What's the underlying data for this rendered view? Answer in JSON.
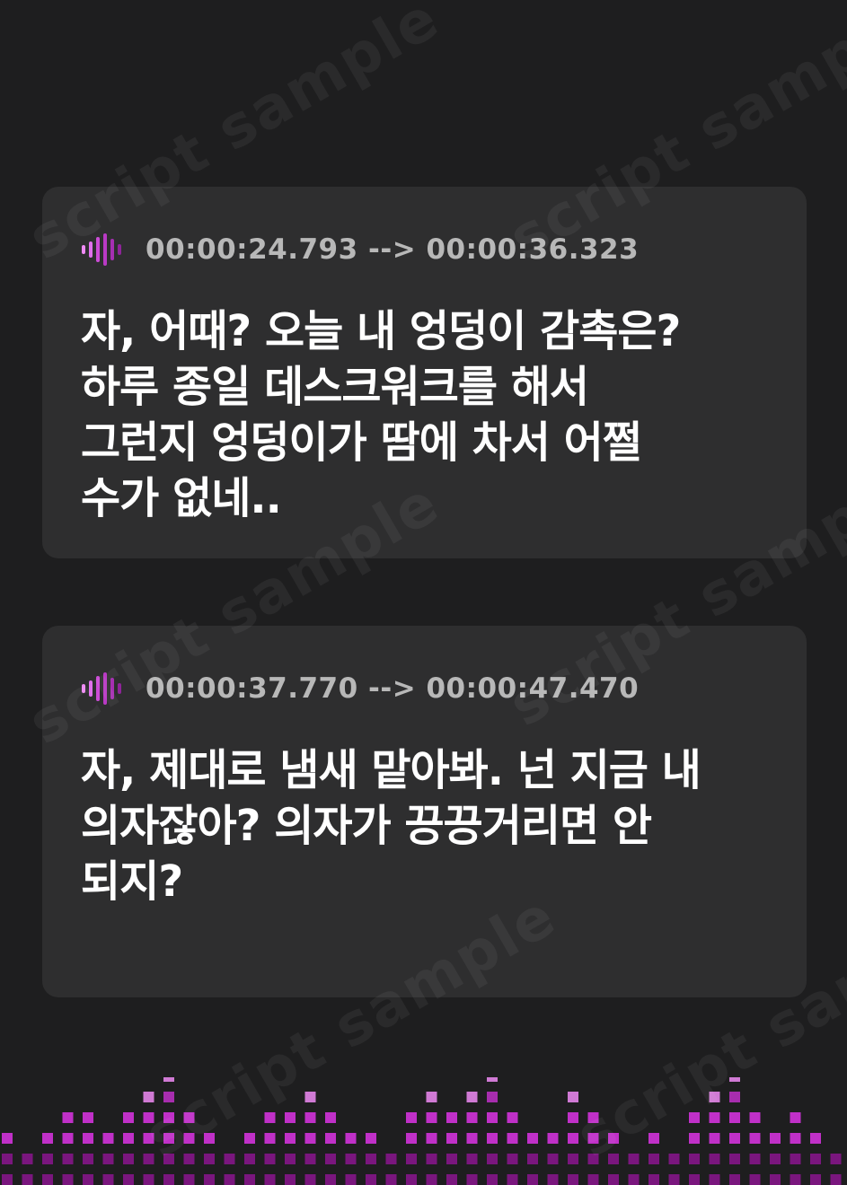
{
  "colors": {
    "background": "#1e1e1f",
    "card": "#2e2e2f",
    "timestamp_text": "#b8b8b8",
    "subtitle_text": "#ffffff",
    "accent_light": "#f08bf5",
    "accent_mid": "#c030c8",
    "accent_dark": "#7a167e"
  },
  "watermark": "script sample",
  "entries": [
    {
      "icon": "audio-wave-icon",
      "timestamp": "00:00:24.793 --> 00:00:36.323",
      "text": "자, 어때? 오늘 내 엉덩이 감촉은?\n하루 종일 데스크워크를 해서\n그런지 엉덩이가 땀에 차서 어쩔\n수가 없네.."
    },
    {
      "icon": "audio-wave-icon",
      "timestamp": "00:00:37.770 --> 00:00:47.470",
      "text": "자, 제대로 냄새 맡아봐. 넌 지금 내\n의자잖아? 의자가 끙끙거리면 안\n되지?"
    }
  ]
}
